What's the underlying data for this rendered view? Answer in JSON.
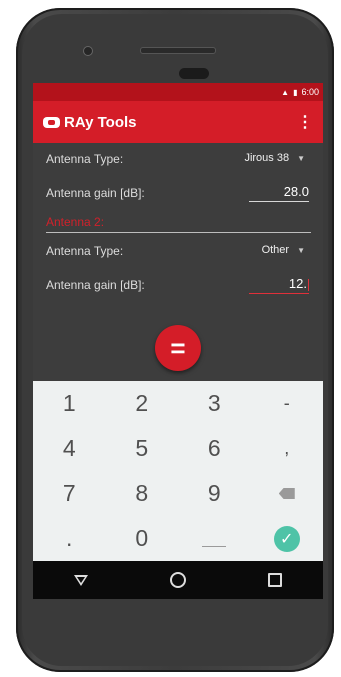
{
  "status": {
    "time": "6:00",
    "network_icon": "signal-icon",
    "battery_icon": "battery-icon"
  },
  "appbar": {
    "title": "RAy Tools",
    "menu_icon": "more-vert-icon",
    "logo_icon": "ray-logo-icon"
  },
  "antenna1": {
    "type_label": "Antenna Type:",
    "type_value": "Jirous 38",
    "gain_label": "Antenna gain [dB]:",
    "gain_value": "28.0"
  },
  "antenna2": {
    "heading": "Antenna 2:",
    "type_label": "Antenna Type:",
    "type_value": "Other",
    "gain_label": "Antenna gain [dB]:",
    "gain_value": "12."
  },
  "fab": {
    "label": "="
  },
  "keypad": {
    "row1": [
      "1",
      "2",
      "3",
      "-"
    ],
    "row2": [
      "4",
      "5",
      "6",
      ","
    ],
    "row3": [
      "7",
      "8",
      "9"
    ],
    "row4": [
      ".",
      "0"
    ],
    "ok_icon": "check-icon",
    "backspace_icon": "backspace-icon"
  },
  "colors": {
    "accent": "#d41d28",
    "statusbar": "#b3121b",
    "ok": "#4ec3a7",
    "background": "#3d3d3d"
  }
}
